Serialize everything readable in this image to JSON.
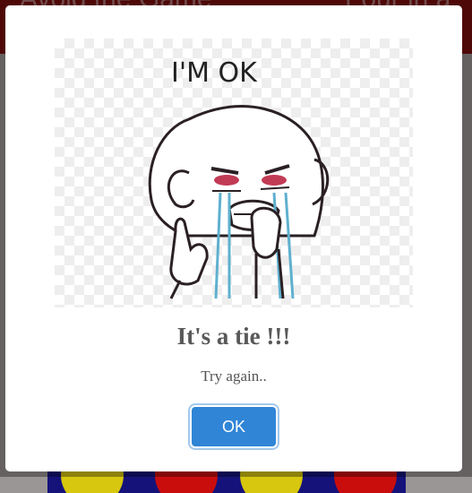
{
  "background": {
    "header_left_text": "Avoid the Game",
    "header_right_text": "Four in a"
  },
  "modal": {
    "image_caption": "I'M OK",
    "title": "It's a tie !!!",
    "message": "Try again..",
    "confirm_label": "OK"
  },
  "colors": {
    "confirm_button": "#3085d6",
    "header_bar": "#7a0d0d",
    "board": "#15127a"
  }
}
